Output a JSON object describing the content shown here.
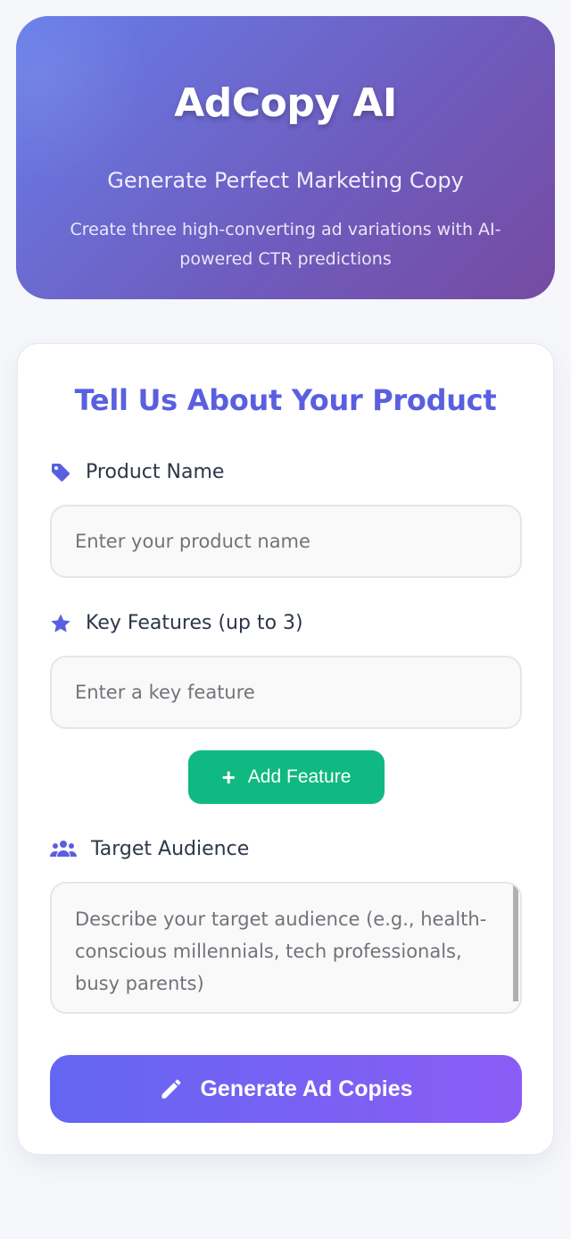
{
  "hero": {
    "title": "AdCopy AI",
    "subtitle": "Generate Perfect Marketing Copy",
    "description": "Create three high-converting ad variations with AI-powered CTR predictions"
  },
  "form": {
    "title": "Tell Us About Your Product",
    "product_name": {
      "label": "Product Name",
      "icon": "tag-icon",
      "placeholder": "Enter your product name",
      "value": ""
    },
    "key_features": {
      "label": "Key Features (up to 3)",
      "icon": "star-icon",
      "placeholder": "Enter a key feature",
      "value": ""
    },
    "add_feature_label": "Add Feature",
    "target_audience": {
      "label": "Target Audience",
      "icon": "users-icon",
      "placeholder": "Describe your target audience (e.g., health-conscious millennials, tech professionals, busy parents)",
      "value": ""
    },
    "generate_label": "Generate Ad Copies"
  },
  "colors": {
    "accent": "#5a5fe0",
    "hero_gradient_start": "#667eea",
    "hero_gradient_end": "#764ba2",
    "add_button": "#10b981",
    "generate_gradient_start": "#6366f1",
    "generate_gradient_end": "#8b5cf6"
  }
}
